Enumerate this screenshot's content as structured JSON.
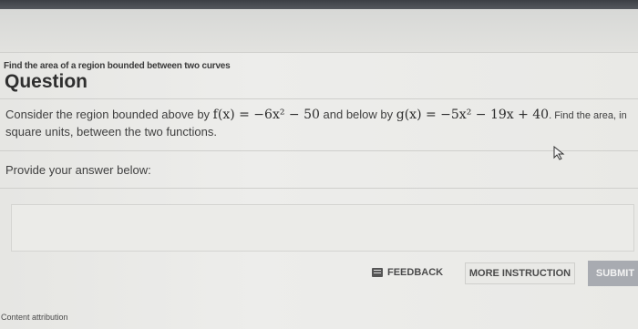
{
  "header": {
    "subtitle": "Find the area of a region bounded between two curves",
    "title": "Question"
  },
  "question": {
    "text_before_f": "Consider the region bounded above by ",
    "f_expr": "f(x) = −6x² − 50",
    "text_between": " and below by ",
    "g_expr": "g(x) = −5x² − 19x + 40",
    "text_after_g": ". Find the area, in",
    "text_line2": "square units, between the two functions."
  },
  "answer": {
    "prompt": "Provide your answer below:",
    "value": ""
  },
  "actions": {
    "feedback_label": "FEEDBACK",
    "more_instruction_label": "MORE INSTRUCTION",
    "submit_label": "SUBMIT"
  },
  "footer": {
    "attribution": "Content attribution"
  },
  "icons": {
    "feedback": "feedback-icon",
    "cursor": "mouse-pointer-icon"
  }
}
